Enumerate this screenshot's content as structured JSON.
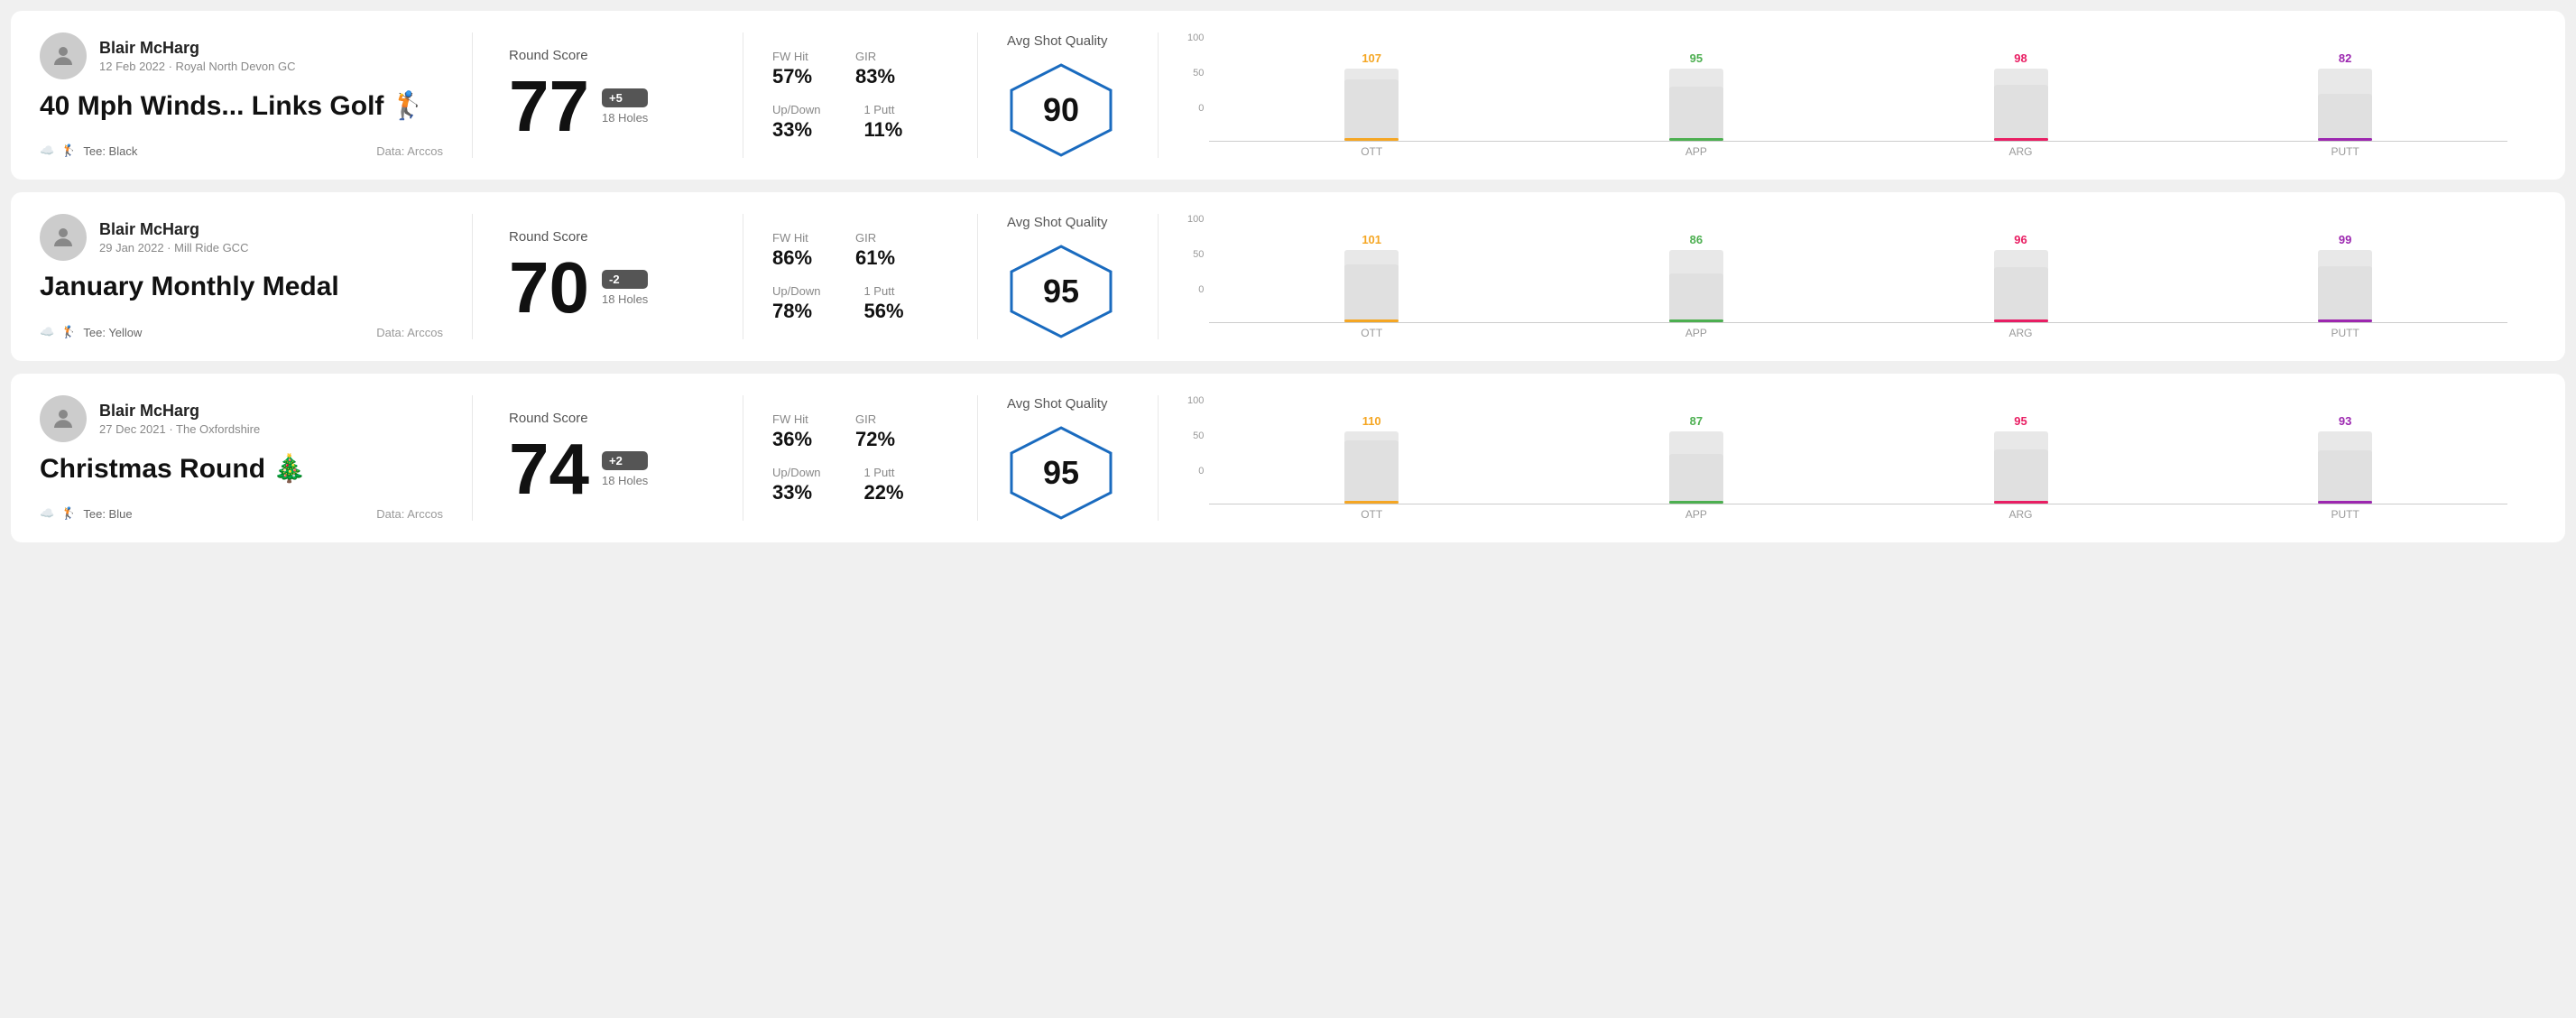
{
  "rounds": [
    {
      "id": "round1",
      "player_name": "Blair McHarg",
      "player_meta": "12 Feb 2022 · Royal North Devon GC",
      "title": "40 Mph Winds... Links Golf 🏌️",
      "tee": "Black",
      "data_source": "Data: Arccos",
      "score": "77",
      "score_diff": "+5",
      "holes": "18 Holes",
      "fw_hit": "57%",
      "gir": "83%",
      "up_down": "33%",
      "one_putt": "11%",
      "avg_quality": "90",
      "chart": {
        "ott": {
          "value": 107,
          "bar_pct": 85
        },
        "app": {
          "value": 95,
          "bar_pct": 75
        },
        "arg": {
          "value": 98,
          "bar_pct": 78
        },
        "putt": {
          "value": 82,
          "bar_pct": 65
        }
      }
    },
    {
      "id": "round2",
      "player_name": "Blair McHarg",
      "player_meta": "29 Jan 2022 · Mill Ride GCC",
      "title": "January Monthly Medal",
      "tee": "Yellow",
      "data_source": "Data: Arccos",
      "score": "70",
      "score_diff": "-2",
      "holes": "18 Holes",
      "fw_hit": "86%",
      "gir": "61%",
      "up_down": "78%",
      "one_putt": "56%",
      "avg_quality": "95",
      "chart": {
        "ott": {
          "value": 101,
          "bar_pct": 80
        },
        "app": {
          "value": 86,
          "bar_pct": 68
        },
        "arg": {
          "value": 96,
          "bar_pct": 76
        },
        "putt": {
          "value": 99,
          "bar_pct": 78
        }
      }
    },
    {
      "id": "round3",
      "player_name": "Blair McHarg",
      "player_meta": "27 Dec 2021 · The Oxfordshire",
      "title": "Christmas Round 🎄",
      "tee": "Blue",
      "data_source": "Data: Arccos",
      "score": "74",
      "score_diff": "+2",
      "holes": "18 Holes",
      "fw_hit": "36%",
      "gir": "72%",
      "up_down": "33%",
      "one_putt": "22%",
      "avg_quality": "95",
      "chart": {
        "ott": {
          "value": 110,
          "bar_pct": 87
        },
        "app": {
          "value": 87,
          "bar_pct": 69
        },
        "arg": {
          "value": 95,
          "bar_pct": 75
        },
        "putt": {
          "value": 93,
          "bar_pct": 74
        }
      }
    }
  ],
  "labels": {
    "round_score": "Round Score",
    "fw_hit": "FW Hit",
    "gir": "GIR",
    "up_down": "Up/Down",
    "one_putt": "1 Putt",
    "avg_shot_quality": "Avg Shot Quality",
    "ott": "OTT",
    "app": "APP",
    "arg": "ARG",
    "putt": "PUTT",
    "axis_100": "100",
    "axis_50": "50",
    "axis_0": "0"
  }
}
